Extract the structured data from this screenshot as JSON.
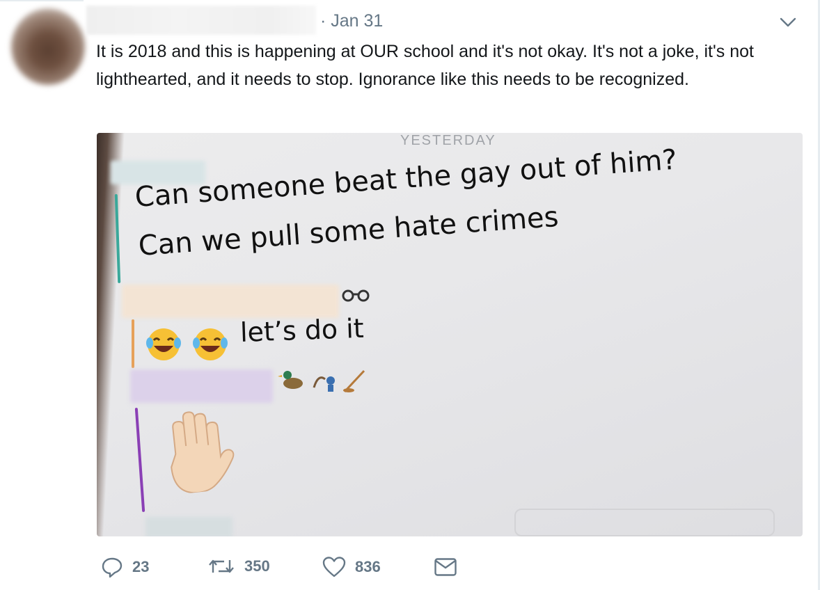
{
  "tweet": {
    "date": "· Jan 31",
    "text": "It is 2018 and this is happening at OUR school and it's not okay. It's not a joke, it's not lighthearted, and it needs to stop. Ignorance like this needs to be recognized."
  },
  "media": {
    "day_label": "YESTERDAY",
    "messages": [
      "Can someone beat the gay out of him?",
      "Can we pull some hate crimes",
      "let’s do it"
    ],
    "bar_colors": {
      "teal": "#3aa89a",
      "orange": "#e6a15a",
      "purple": "#8a3fb5"
    }
  },
  "actions": {
    "reply_count": "23",
    "retweet_count": "350",
    "like_count": "836"
  },
  "icons": [
    "chevron-down-icon",
    "reply-icon",
    "retweet-icon",
    "heart-icon",
    "envelope-icon",
    "sunglasses-emoji",
    "laughing-crying-emoji",
    "duck-emoji",
    "hand-emoji"
  ],
  "colors": {
    "meta_text": "#657786",
    "text": "#14171a"
  }
}
